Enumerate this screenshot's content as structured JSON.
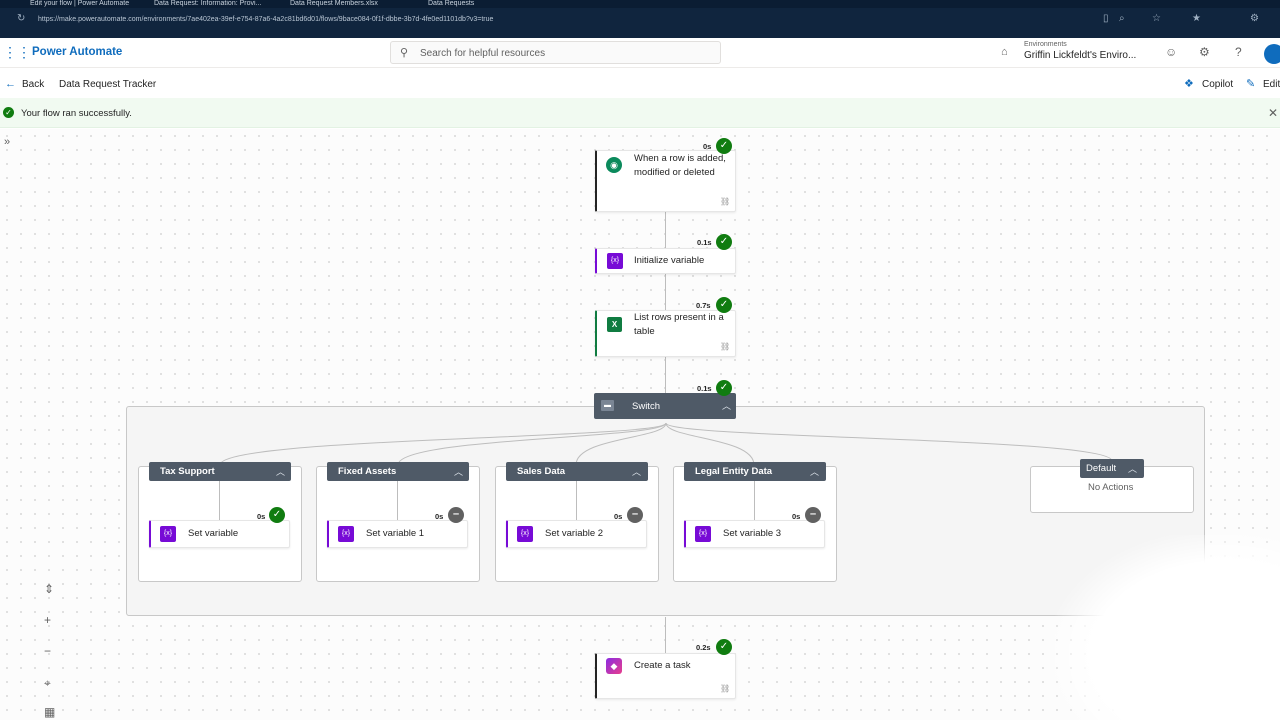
{
  "browser": {
    "tabs": [
      {
        "label": "Edit your flow | Power Automate"
      },
      {
        "label": "Data Request: Information: Provi..."
      },
      {
        "label": "Data Request Members.xlsx"
      },
      {
        "label": "Data Requests"
      }
    ],
    "url": "https://make.powerautomate.com/environments/7ae402ea-39ef-e754-87a6-4a2c81bd6d01/flows/9bace084-0f1f-dbbe-3b7d-4fe0ed1101db?v3=true"
  },
  "header": {
    "app_name": "Power Automate",
    "search_placeholder": "Search for helpful resources",
    "environment_label": "Environments",
    "environment_name": "Griffin Lickfeldt's Enviro..."
  },
  "commandbar": {
    "back_label": "Back",
    "flow_name": "Data Request Tracker",
    "copilot_label": "Copilot",
    "edit_label": "Edit"
  },
  "banner": {
    "message": "Your flow ran successfully."
  },
  "flow": {
    "trigger": {
      "title": "When a row is added, modified or deleted",
      "duration": "0s",
      "status": "succeeded"
    },
    "init_variable": {
      "title": "Initialize variable",
      "duration": "0.1s",
      "status": "succeeded"
    },
    "list_rows": {
      "title": "List rows present in a table",
      "duration": "0.7s",
      "status": "succeeded"
    },
    "switch": {
      "title": "Switch",
      "duration": "0.1s",
      "status": "succeeded"
    },
    "cases": [
      {
        "label": "Tax Support",
        "action": "Set variable",
        "duration": "0s",
        "status": "succeeded"
      },
      {
        "label": "Fixed Assets",
        "action": "Set variable 1",
        "duration": "0s",
        "status": "skipped"
      },
      {
        "label": "Sales Data",
        "action": "Set variable 2",
        "duration": "0s",
        "status": "skipped"
      },
      {
        "label": "Legal Entity Data",
        "action": "Set variable 3",
        "duration": "0s",
        "status": "skipped"
      }
    ],
    "default_case": {
      "label": "Default",
      "text": "No Actions"
    },
    "create_task": {
      "title": "Create a task",
      "duration": "0.2s",
      "status": "succeeded"
    }
  },
  "icons": {
    "trigger": "dataverse-icon",
    "variable": "variable-icon",
    "excel": "excel-icon",
    "planner": "planner-icon"
  },
  "colors": {
    "brand": "#0f6cbd",
    "success": "#107c10",
    "skipped": "#616161",
    "variable": "#770bd6",
    "switch_header": "#4f5a67"
  }
}
